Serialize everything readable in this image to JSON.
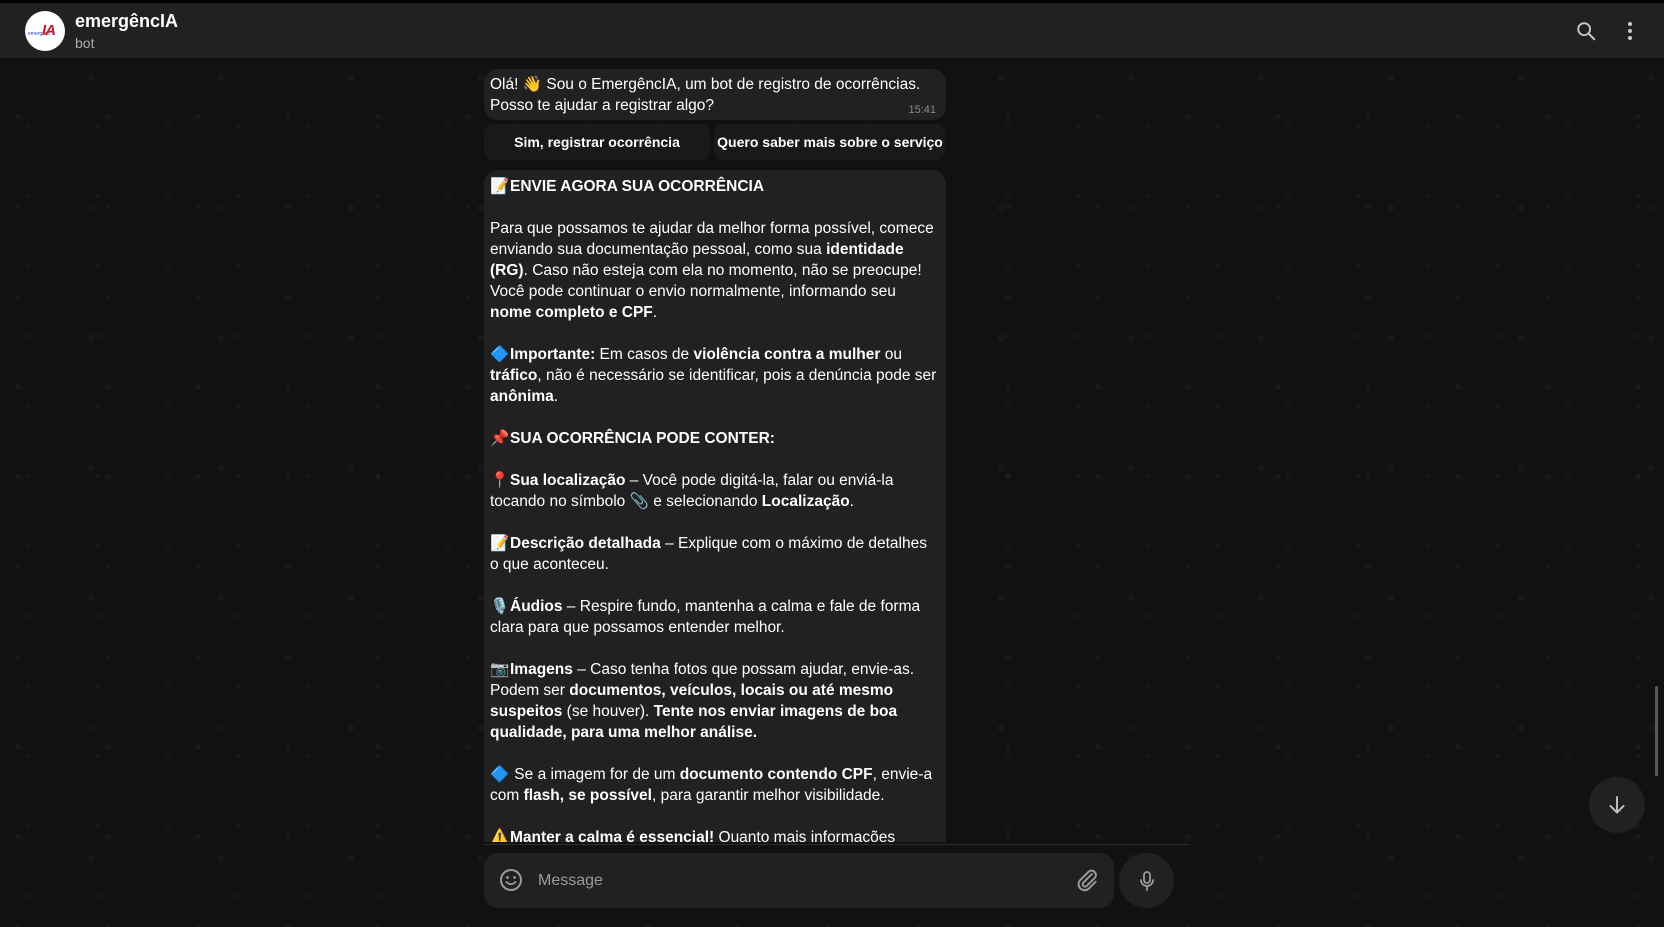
{
  "header": {
    "title": "emergêncIA",
    "subtitle": "bot",
    "avatar_text": "IA",
    "avatar_small_text": "emergênc",
    "search_icon": "search-icon",
    "menu_icon": "more-vertical-icon"
  },
  "messages": {
    "welcome": {
      "text_pre": "Olá! ",
      "wave": "👋",
      "text_post": " Sou o EmergêncIA, um bot de registro de ocorrências. Posso te ajudar a registrar algo?",
      "time": "15:41"
    },
    "keyboard": {
      "btn_register": "Sim, registrar ocorrência",
      "btn_info": "Quero saber mais sobre o serviço"
    },
    "instructions": {
      "heading_emoji": "📝",
      "heading": "ENVIE AGORA SUA OCORRÊNCIA",
      "p1_a": "Para que possamos te ajudar da melhor forma possível, comece enviando sua documentação pessoal, como sua ",
      "p1_b": "identidade (RG)",
      "p1_c": ". Caso não esteja com ela no momento, não se preocupe! Você pode continuar o envio normalmente, informando seu ",
      "p1_d": "nome completo e CPF",
      "p1_e": ".",
      "p2_emoji": "🔷",
      "p2_a": "Importante:",
      "p2_b": " Em casos de ",
      "p2_c": "violência contra a mulher",
      "p2_d": " ou ",
      "p2_e": "tráfico",
      "p2_f": ", não é necessário se identificar, pois a denúncia pode ser ",
      "p2_g": "anônima",
      "p2_h": ".",
      "p3_emoji": "📌",
      "p3": "SUA OCORRÊNCIA PODE CONTER:",
      "p4_emoji": "📍",
      "p4_a": "Sua localização",
      "p4_b": " – Você pode digitá-la, falar ou enviá-la tocando no símbolo ",
      "p4_clip": "📎",
      "p4_c": " e selecionando ",
      "p4_d": "Localização",
      "p4_e": ".",
      "p5_emoji": "📝",
      "p5_a": "Descrição detalhada",
      "p5_b": " – Explique com o máximo de detalhes o que aconteceu.",
      "p6_emoji": "🎙️",
      "p6_a": "Áudios",
      "p6_b": " – Respire fundo, mantenha a calma e fale de forma clara para que possamos entender melhor.",
      "p7_emoji": "📷",
      "p7_a": "Imagens",
      "p7_b": " – Caso tenha fotos que possam ajudar, envie-as. Podem ser ",
      "p7_c": "documentos, veículos, locais ou até mesmo suspeitos",
      "p7_d": " (se houver). ",
      "p7_e": "Tente nos enviar imagens de boa qualidade, para uma melhor análise.",
      "p8_emoji": "🔷",
      "p8_a": " Se a imagem for de um ",
      "p8_b": "documento contendo CPF",
      "p8_c": ", envie-a com ",
      "p8_d": "flash, se possível",
      "p8_e": ", para garantir melhor visibilidade.",
      "p9_emoji": "⚠️",
      "p9_a": "Manter a calma é essencial!",
      "p9_b": " Quanto mais informações"
    }
  },
  "composer": {
    "placeholder": "Message",
    "emoji_icon": "smile-icon",
    "attach_icon": "paperclip-icon",
    "mic_icon": "microphone-icon"
  },
  "colors": {
    "background": "#111111",
    "bubble": "#212121",
    "accent_logo": "#d3162c"
  }
}
